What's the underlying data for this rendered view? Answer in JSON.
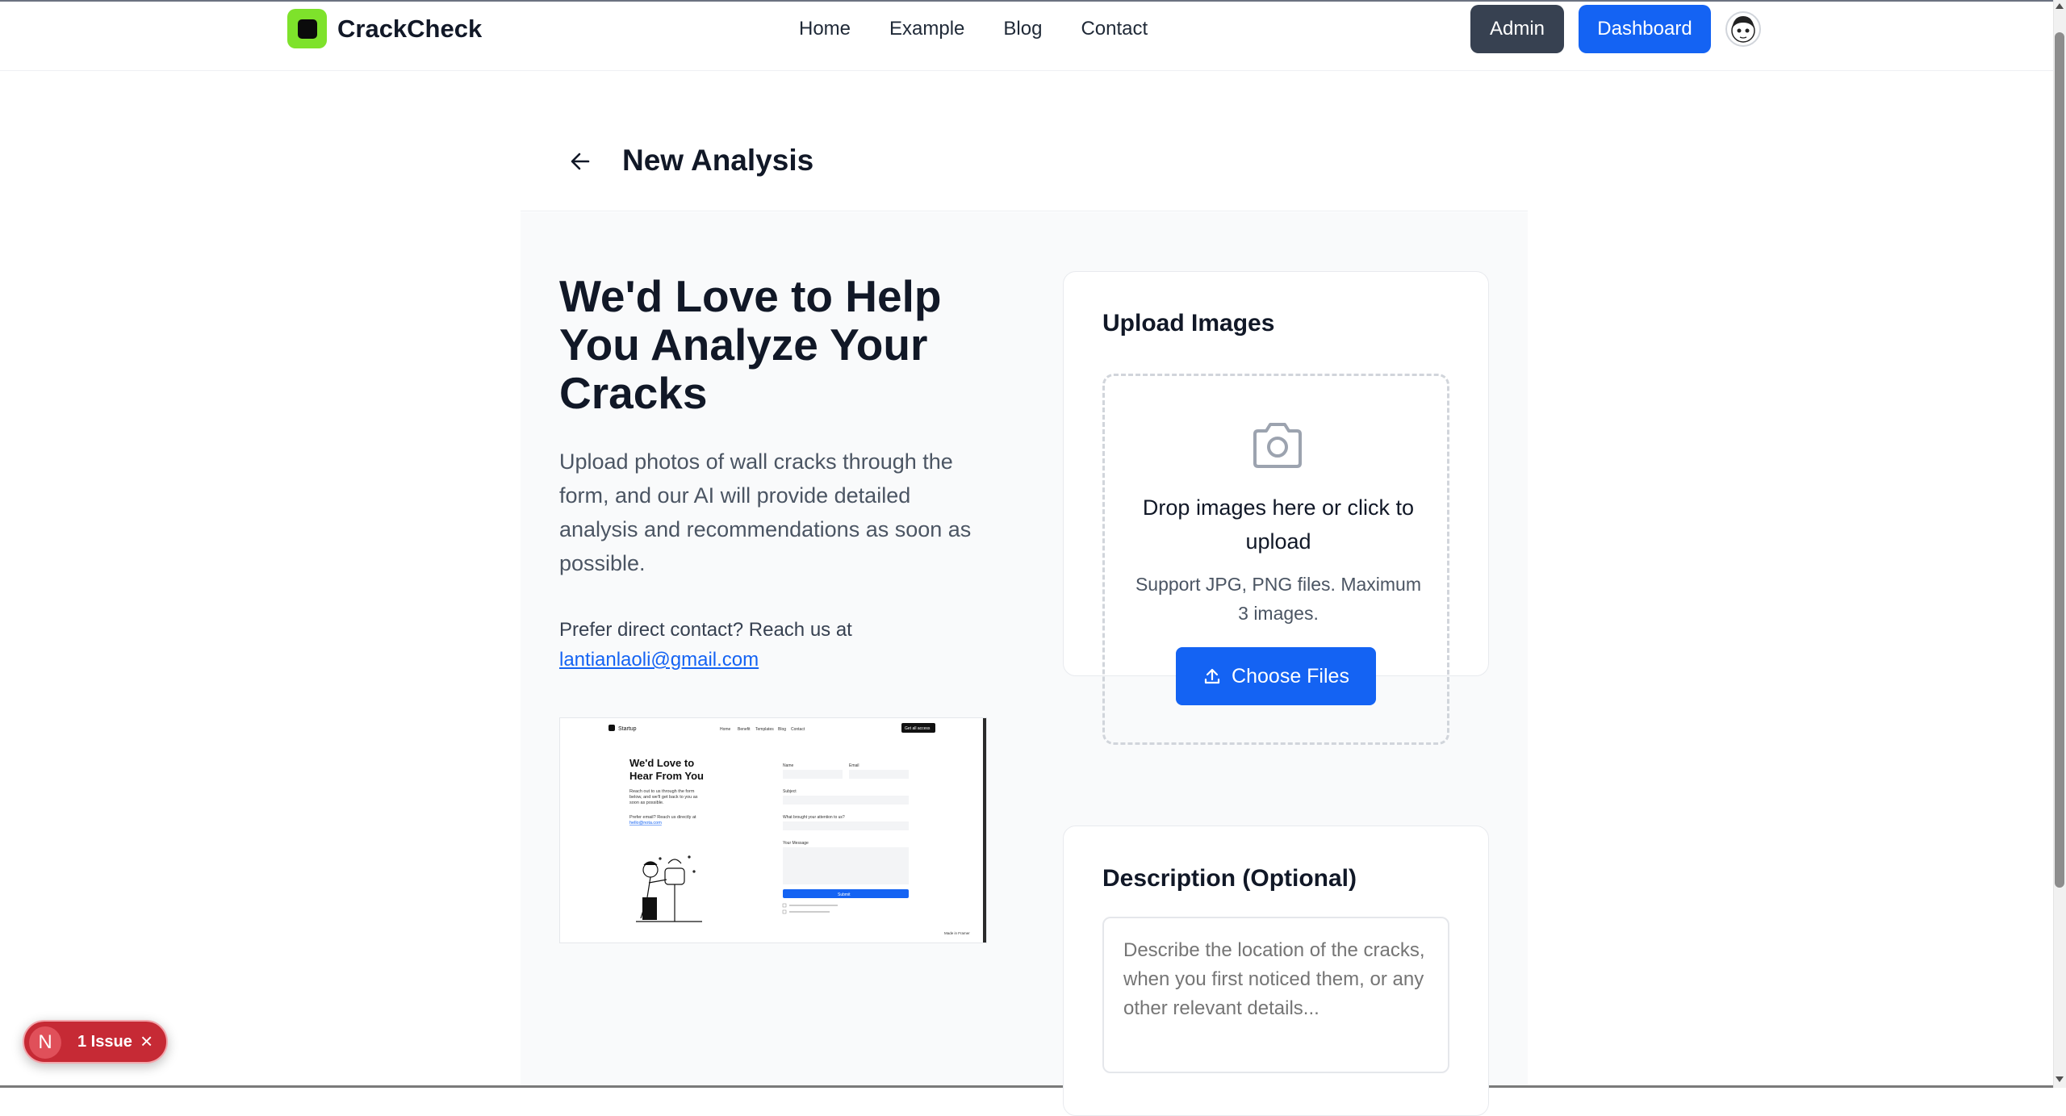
{
  "header": {
    "brand": "CrackCheck",
    "nav": [
      "Home",
      "Example",
      "Blog",
      "Contact"
    ],
    "admin_label": "Admin",
    "dashboard_label": "Dashboard"
  },
  "page": {
    "title": "New Analysis"
  },
  "hero": {
    "title": "We'd Love to Help You Analyze Your Cracks",
    "description": "Upload photos of wall cracks through the form, and our AI will provide detailed analysis and recommendations as soon as possible.",
    "contact_prefix": "Prefer direct contact? Reach us at",
    "contact_email": "lantianlaoli@gmail.com"
  },
  "preview": {
    "brand": "Startup",
    "nav": [
      "Home",
      "Benefit",
      "Templates",
      "Blog",
      "Contact"
    ],
    "cta": "Get all access",
    "heading": "We'd Love to Hear From You",
    "text": "Reach out to us through the form below, and we'll get back to you as soon as possible.",
    "email_prefix": "Prefer email? Reach us directly at",
    "email": "hello@nota.com",
    "fields": [
      "Name",
      "Email",
      "Subject",
      "What brought your attention to us?",
      "Your Message"
    ],
    "submit": "Submit",
    "footer": "Made in Framer"
  },
  "upload": {
    "title": "Upload Images",
    "drop_text": "Drop images here or click to upload",
    "support_text": "Support JPG, PNG files. Maximum 3 images.",
    "button": "Choose Files"
  },
  "description": {
    "title": "Description (Optional)",
    "placeholder": "Describe the location of the cracks, when you first noticed them, or any other relevant details..."
  },
  "issue_badge": {
    "initial": "N",
    "label": "1 Issue"
  },
  "colors": {
    "brand_green": "#7ee22b",
    "primary_blue": "#1463f3",
    "admin_gray": "#374151",
    "issue_red": "#c62a35"
  }
}
